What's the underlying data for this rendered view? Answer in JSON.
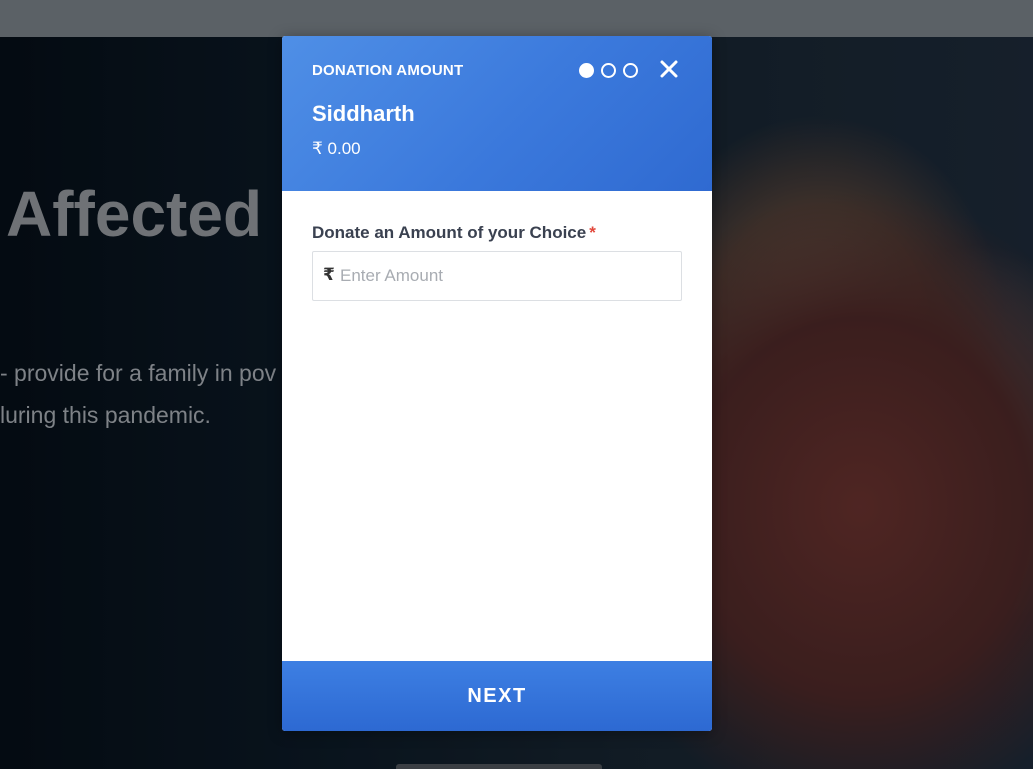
{
  "background": {
    "heading": "Affected",
    "lines": [
      "- provide for a family in pov",
      "luring this pandemic."
    ]
  },
  "modal": {
    "title": "DONATION AMOUNT",
    "steps": [
      {
        "state": "active"
      },
      {
        "state": "inactive"
      },
      {
        "state": "inactive"
      }
    ],
    "close_icon": "close-icon",
    "recipient_name": "Siddharth",
    "amount_display": "₹ 0.00",
    "field_label": "Donate an Amount of your Choice",
    "required_marker": "*",
    "currency_symbol": "₹",
    "amount_placeholder": "Enter Amount",
    "amount_value": "",
    "next_label": "NEXT"
  },
  "colors": {
    "accent": "#3b79dc",
    "required": "#e2473b"
  }
}
